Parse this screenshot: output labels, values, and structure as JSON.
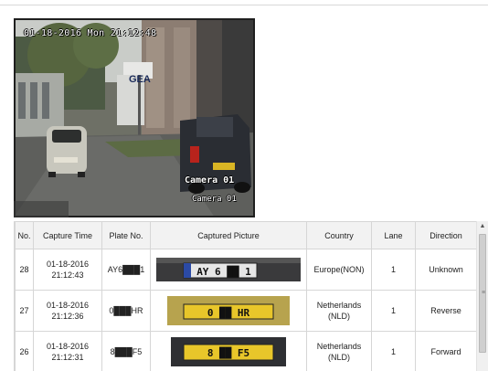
{
  "camera": {
    "timestamp": "01-18-2016 Mon 21:12:48",
    "channel_label": "Camera 01",
    "channel_label_ghost": "Camera 01",
    "sign_text": "GEA"
  },
  "table": {
    "headers": [
      "No.",
      "Capture Time",
      "Plate No.",
      "Captured Picture",
      "Country",
      "Lane",
      "Direction"
    ],
    "rows": [
      {
        "no": "28",
        "time_date": "01-18-2016",
        "time_clock": "21:12:43",
        "plate": "AY6███1",
        "picture_text": "AY 6 ██ 1",
        "country": "Europe(NON)",
        "country_code": "",
        "lane": "1",
        "direction": "Unknown"
      },
      {
        "no": "27",
        "time_date": "01-18-2016",
        "time_clock": "21:12:36",
        "plate": "0███HR",
        "picture_text": "0 ██ HR",
        "country": "Netherlands",
        "country_code": "(NLD)",
        "lane": "1",
        "direction": "Reverse"
      },
      {
        "no": "26",
        "time_date": "01-18-2016",
        "time_clock": "21:12:31",
        "plate": "8███F5",
        "picture_text": "8 ██ F5",
        "country": "Netherlands",
        "country_code": "(NLD)",
        "lane": "1",
        "direction": "Forward"
      }
    ]
  },
  "colors": {
    "header_bg": "#f2f2f2",
    "border": "#d6d6d6",
    "plate_yellow": "#e8c62a",
    "plate_white": "#f4f4f4"
  }
}
